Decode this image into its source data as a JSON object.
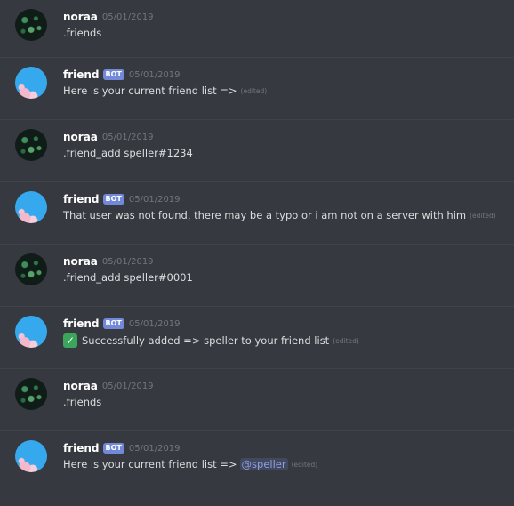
{
  "messages": [
    {
      "author": "noraa",
      "bot": false,
      "time": "05/01/2019",
      "text": ".friends",
      "edited": ""
    },
    {
      "author": "friend",
      "bot": true,
      "bot_tag": "BOT",
      "time": "05/01/2019",
      "text": "Here is your current friend list =>",
      "edited": "(edited)"
    },
    {
      "author": "noraa",
      "bot": false,
      "time": "05/01/2019",
      "text": ".friend_add speller#1234",
      "edited": ""
    },
    {
      "author": "friend",
      "bot": true,
      "bot_tag": "BOT",
      "time": "05/01/2019",
      "text": "That user was not found, there may be a typo or i am not on a server with him",
      "edited": "(edited)"
    },
    {
      "author": "noraa",
      "bot": false,
      "time": "05/01/2019",
      "text": ".friend_add speller#0001",
      "edited": ""
    },
    {
      "author": "friend",
      "bot": true,
      "bot_tag": "BOT",
      "time": "05/01/2019",
      "text": "Successfully added => speller to your friend list",
      "edited": "(edited)",
      "icon": "check-mark-icon"
    },
    {
      "author": "noraa",
      "bot": false,
      "time": "05/01/2019",
      "text": ".friends",
      "edited": ""
    },
    {
      "author": "friend",
      "bot": true,
      "bot_tag": "BOT",
      "time": "05/01/2019",
      "text": "Here is your current friend list =>",
      "mention": "@speller",
      "edited": "(edited)"
    }
  ]
}
